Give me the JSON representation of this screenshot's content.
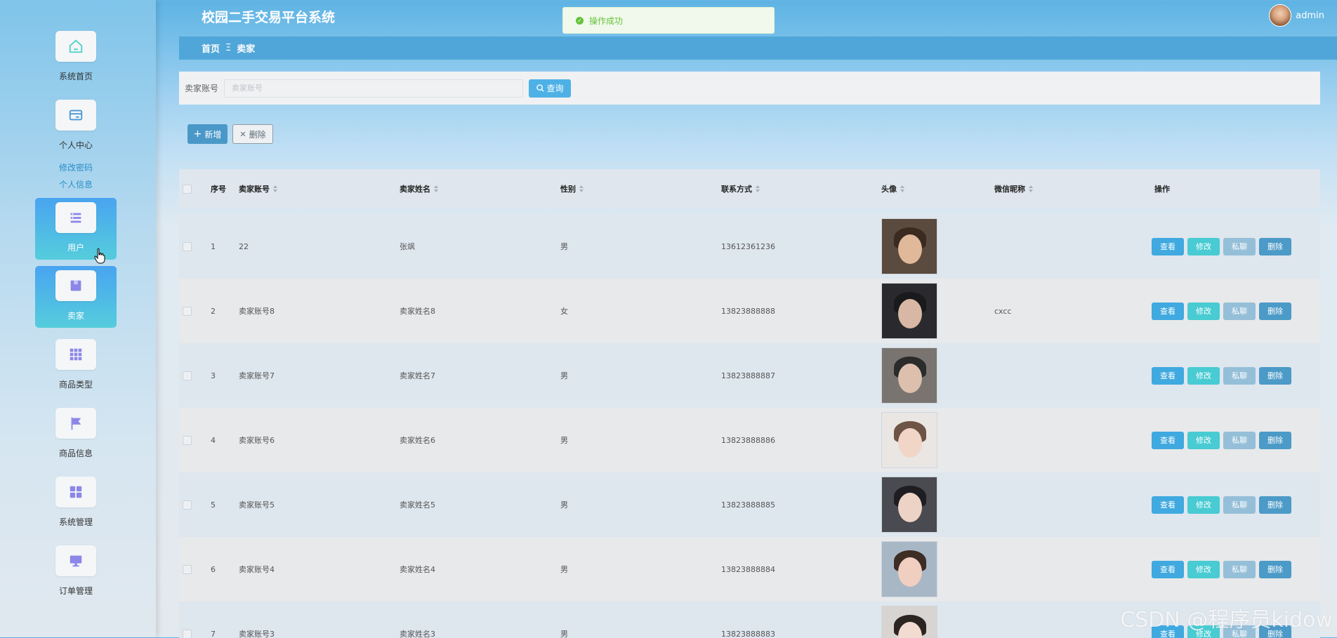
{
  "header": {
    "app_title": "校园二手交易平台系统",
    "username": "admin",
    "toast": "操作成功"
  },
  "breadcrumb": {
    "home": "首页",
    "separator": "Ξ",
    "current": "卖家"
  },
  "sidebar": {
    "items": [
      {
        "label": "系统首页",
        "icon": "home-icon"
      },
      {
        "label": "个人中心",
        "icon": "card-icon"
      },
      {
        "label": "用户",
        "icon": "list-icon"
      },
      {
        "label": "卖家",
        "icon": "box-icon"
      },
      {
        "label": "商品类型",
        "icon": "grid-icon"
      },
      {
        "label": "商品信息",
        "icon": "flag-icon"
      },
      {
        "label": "系统管理",
        "icon": "apps-icon"
      },
      {
        "label": "订单管理",
        "icon": "monitor-icon"
      }
    ],
    "sub_links": [
      "修改密码",
      "个人信息"
    ]
  },
  "search": {
    "label": "卖家账号",
    "placeholder": "卖家账号",
    "value": "",
    "button": "查询"
  },
  "actions": {
    "add": "新增",
    "delete": "删除"
  },
  "table": {
    "columns": [
      "序号",
      "卖家账号",
      "卖家姓名",
      "性别",
      "联系方式",
      "头像",
      "微信昵称",
      "操作"
    ],
    "rows": [
      {
        "index": "1",
        "account": "22",
        "name": "张飒",
        "gender": "男",
        "phone": "13612361236",
        "wechat": ""
      },
      {
        "index": "2",
        "account": "卖家账号8",
        "name": "卖家姓名8",
        "gender": "女",
        "phone": "13823888888",
        "wechat": "cxcc"
      },
      {
        "index": "3",
        "account": "卖家账号7",
        "name": "卖家姓名7",
        "gender": "男",
        "phone": "13823888887",
        "wechat": ""
      },
      {
        "index": "4",
        "account": "卖家账号6",
        "name": "卖家姓名6",
        "gender": "男",
        "phone": "13823888886",
        "wechat": ""
      },
      {
        "index": "5",
        "account": "卖家账号5",
        "name": "卖家姓名5",
        "gender": "男",
        "phone": "13823888885",
        "wechat": ""
      },
      {
        "index": "6",
        "account": "卖家账号4",
        "name": "卖家姓名4",
        "gender": "男",
        "phone": "13823888884",
        "wechat": ""
      },
      {
        "index": "7",
        "account": "卖家账号3",
        "name": "卖家姓名3",
        "gender": "男",
        "phone": "13823888883",
        "wechat": ""
      }
    ],
    "row_actions": [
      "查看",
      "修改",
      "私聊",
      "删除"
    ]
  },
  "watermark": "CSDN @程序员kidow",
  "colors": {
    "accent": "#50a6d8",
    "active_menu_top": "#49a4f0",
    "active_menu_bottom": "#55cddc",
    "success": "#67c23a"
  }
}
